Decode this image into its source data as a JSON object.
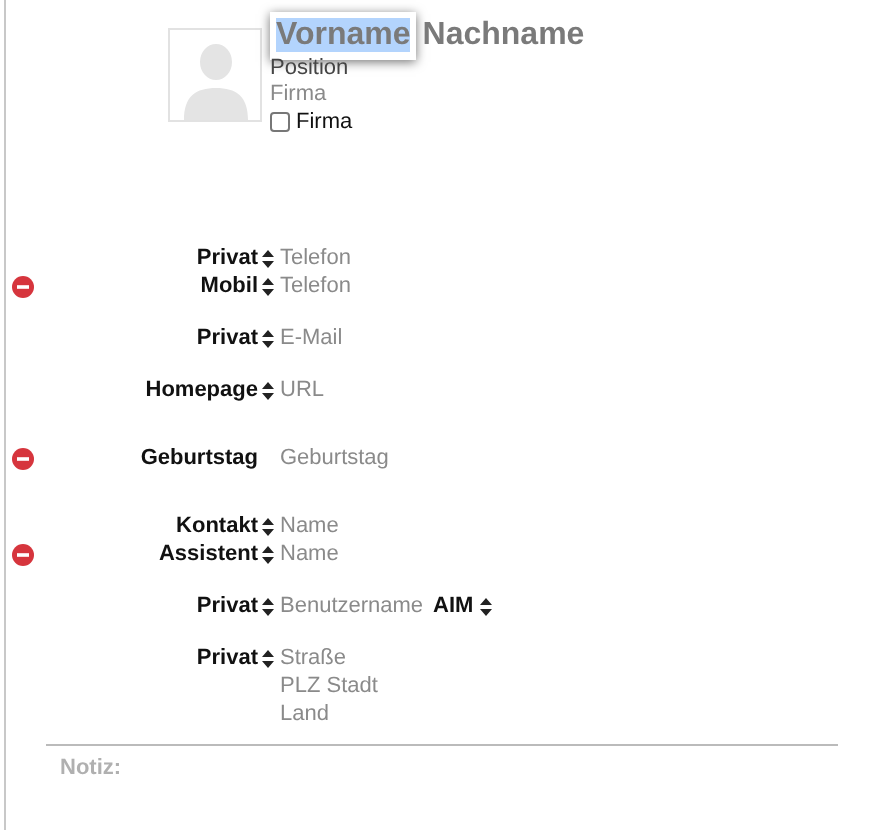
{
  "card": {
    "first_name": {
      "value": "Vorname",
      "selected": true
    },
    "last_name": "Nachname",
    "position": "Position",
    "company": "Firma",
    "company_checkbox": {
      "label": "Firma",
      "checked": false
    }
  },
  "groups": [
    {
      "rows": [
        {
          "label": "Privat",
          "stepper": true,
          "removable": false,
          "values": [
            "Telefon"
          ]
        },
        {
          "label": "Mobil",
          "stepper": true,
          "removable": true,
          "values": [
            "Telefon"
          ]
        }
      ]
    },
    {
      "rows": [
        {
          "label": "Privat",
          "stepper": true,
          "removable": false,
          "values": [
            "E-Mail"
          ]
        }
      ]
    },
    {
      "rows": [
        {
          "label": "Homepage",
          "stepper": true,
          "removable": false,
          "values": [
            "URL"
          ]
        }
      ]
    },
    {
      "rows": [
        {
          "label": "Geburtstag",
          "stepper": false,
          "removable": true,
          "values": [
            "Geburtstag"
          ]
        }
      ]
    },
    {
      "rows": [
        {
          "label": "Kontakt",
          "stepper": true,
          "removable": false,
          "values": [
            "Name"
          ]
        },
        {
          "label": "Assistent",
          "stepper": true,
          "removable": true,
          "values": [
            "Name"
          ]
        }
      ]
    },
    {
      "rows": [
        {
          "label": "Privat",
          "stepper": true,
          "removable": false,
          "values": [
            "Benutzername"
          ],
          "service": "AIM"
        }
      ]
    },
    {
      "rows": [
        {
          "label": "Privat",
          "stepper": true,
          "removable": false,
          "values": [
            "Straße",
            "PLZ Stadt",
            "Land"
          ]
        }
      ]
    }
  ],
  "note": {
    "label": "Notiz:"
  }
}
